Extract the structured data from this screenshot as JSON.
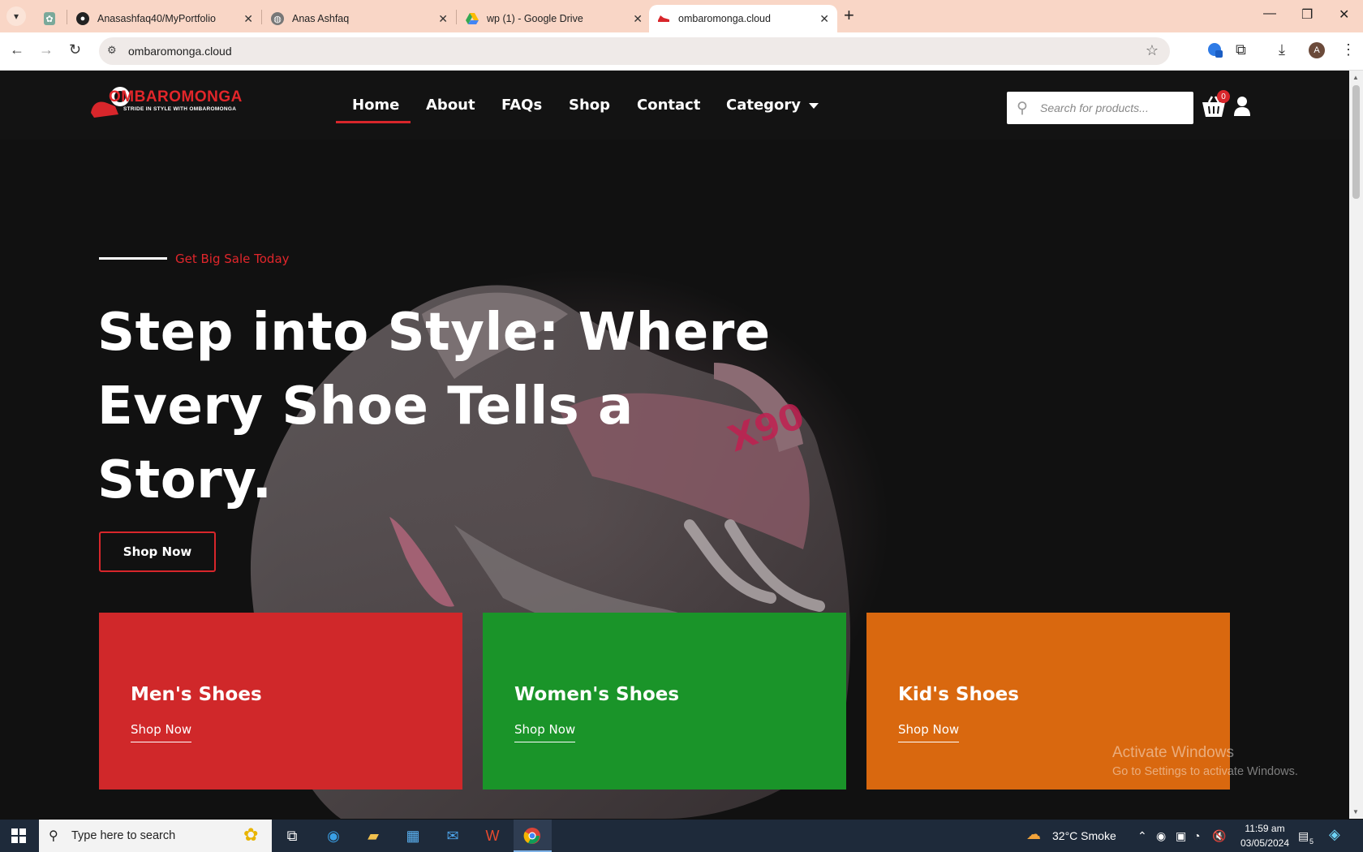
{
  "browser": {
    "tabs": [
      {
        "title": "",
        "favicon": "chatgpt-icon"
      },
      {
        "title": "Anasashfaq40/MyPortfolio",
        "favicon": "github-icon"
      },
      {
        "title": "Anas Ashfaq",
        "favicon": "globe-icon"
      },
      {
        "title": "wp (1) - Google Drive",
        "favicon": "google-drive-icon"
      },
      {
        "title": "ombaromonga.cloud",
        "favicon": "shoe-icon",
        "active": true
      }
    ],
    "url": "ombaromonga.cloud",
    "profile_initial": "A"
  },
  "site": {
    "logo_title": "OMBAROMONGA",
    "logo_tagline": "STRIDE IN STYLE WITH OMBAROMONGA",
    "nav": [
      "Home",
      "About",
      "FAQs",
      "Shop",
      "Contact",
      "Category"
    ],
    "active_nav": "Home",
    "search_placeholder": "Search for products...",
    "cart_count": "0",
    "accent_color": "#d8262b"
  },
  "hero": {
    "kicker": "Get Big Sale Today",
    "headline_lines": [
      "Step into Style: Where",
      "Every Shoe Tells a",
      "Story."
    ],
    "cta": "Shop Now"
  },
  "cards": [
    {
      "title": "Men's Shoes",
      "link": "Shop Now",
      "color": "#d0282a"
    },
    {
      "title": "Women's Shoes",
      "link": "Shop Now",
      "color": "#1a9429"
    },
    {
      "title": "Kid's Shoes",
      "link": "Shop Now",
      "color": "#d9680f"
    }
  ],
  "watermark": {
    "line1": "Activate Windows",
    "line2": "Go to Settings to activate Windows."
  },
  "taskbar": {
    "search_placeholder": "Type here to search",
    "weather": "32°C  Smoke",
    "time": "11:59 am",
    "date": "03/05/2024",
    "notification_count": "5"
  }
}
